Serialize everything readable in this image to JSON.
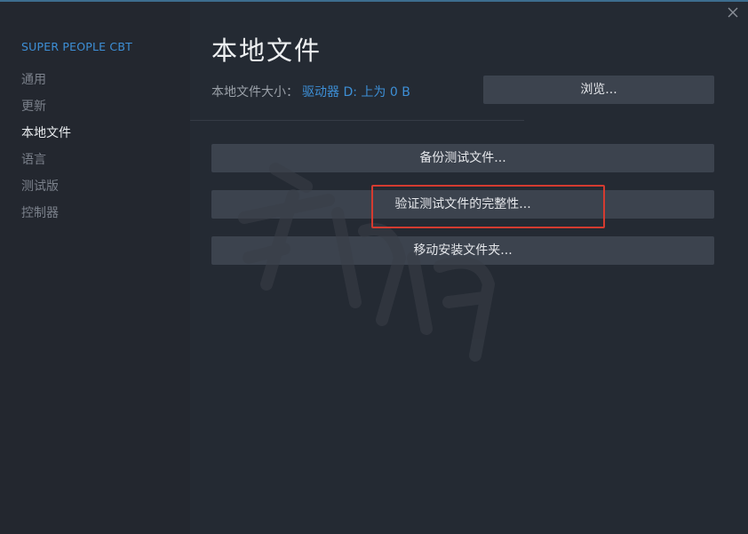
{
  "sidebar": {
    "game_title": "SUPER PEOPLE CBT",
    "items": [
      {
        "label": "通用",
        "active": false
      },
      {
        "label": "更新",
        "active": false
      },
      {
        "label": "本地文件",
        "active": true
      },
      {
        "label": "语言",
        "active": false
      },
      {
        "label": "测试版",
        "active": false
      },
      {
        "label": "控制器",
        "active": false
      }
    ]
  },
  "main": {
    "title": "本地文件",
    "size_label": "本地文件大小：",
    "size_value": "驱动器 D: 上为 0 B",
    "browse_label": "浏览...",
    "buttons": {
      "backup": "备份测试文件...",
      "verify": "验证测试文件的完整性...",
      "move": "移动安装文件夹..."
    }
  },
  "window": {
    "close_icon": "close-icon"
  },
  "colors": {
    "accent": "#3d8fd6",
    "highlight": "#d43b30"
  }
}
